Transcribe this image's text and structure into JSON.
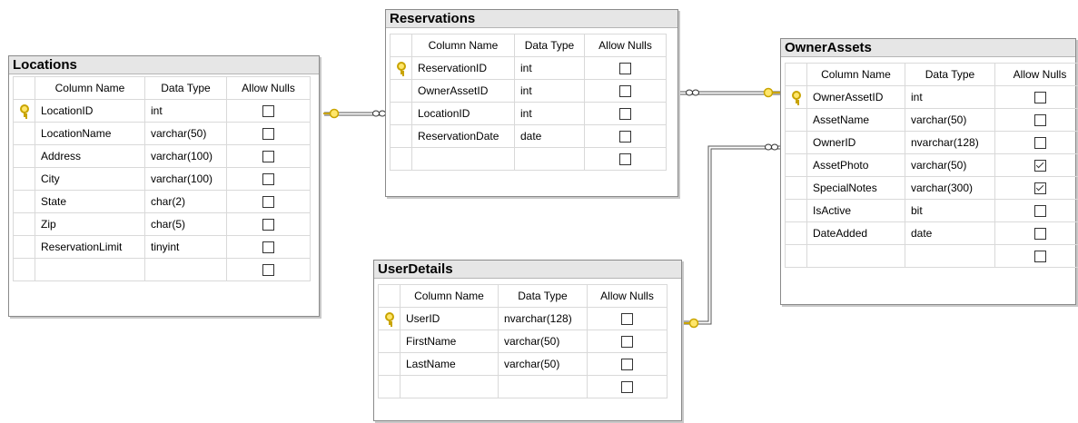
{
  "columns_header": {
    "name": "Column Name",
    "type": "Data Type",
    "nulls": "Allow Nulls"
  },
  "tables": {
    "locations": {
      "title": "Locations",
      "rows": [
        {
          "name": "LocationID",
          "type": "int",
          "nulls": false,
          "pk": true
        },
        {
          "name": "LocationName",
          "type": "varchar(50)",
          "nulls": false
        },
        {
          "name": "Address",
          "type": "varchar(100)",
          "nulls": false
        },
        {
          "name": "City",
          "type": "varchar(100)",
          "nulls": false
        },
        {
          "name": "State",
          "type": "char(2)",
          "nulls": false
        },
        {
          "name": "Zip",
          "type": "char(5)",
          "nulls": false
        },
        {
          "name": "ReservationLimit",
          "type": "tinyint",
          "nulls": false
        }
      ]
    },
    "reservations": {
      "title": "Reservations",
      "rows": [
        {
          "name": "ReservationID",
          "type": "int",
          "nulls": false,
          "pk": true
        },
        {
          "name": "OwnerAssetID",
          "type": "int",
          "nulls": false
        },
        {
          "name": "LocationID",
          "type": "int",
          "nulls": false
        },
        {
          "name": "ReservationDate",
          "type": "date",
          "nulls": false
        }
      ]
    },
    "userdetails": {
      "title": "UserDetails",
      "rows": [
        {
          "name": "UserID",
          "type": "nvarchar(128)",
          "nulls": false,
          "pk": true
        },
        {
          "name": "FirstName",
          "type": "varchar(50)",
          "nulls": false
        },
        {
          "name": "LastName",
          "type": "varchar(50)",
          "nulls": false
        }
      ]
    },
    "ownerassets": {
      "title": "OwnerAssets",
      "rows": [
        {
          "name": "OwnerAssetID",
          "type": "int",
          "nulls": false,
          "pk": true
        },
        {
          "name": "AssetName",
          "type": "varchar(50)",
          "nulls": false
        },
        {
          "name": "OwnerID",
          "type": "nvarchar(128)",
          "nulls": false
        },
        {
          "name": "AssetPhoto",
          "type": "varchar(50)",
          "nulls": true
        },
        {
          "name": "SpecialNotes",
          "type": "varchar(300)",
          "nulls": true
        },
        {
          "name": "IsActive",
          "type": "bit",
          "nulls": false
        },
        {
          "name": "DateAdded",
          "type": "date",
          "nulls": false
        }
      ]
    }
  },
  "colors": {
    "key": "#c9a400",
    "line": "#555555",
    "header_bg": "#e6e6e6"
  },
  "icons": [
    "primary-key-icon",
    "relationship-key-icon",
    "relationship-infinity-icon",
    "checkbox"
  ]
}
